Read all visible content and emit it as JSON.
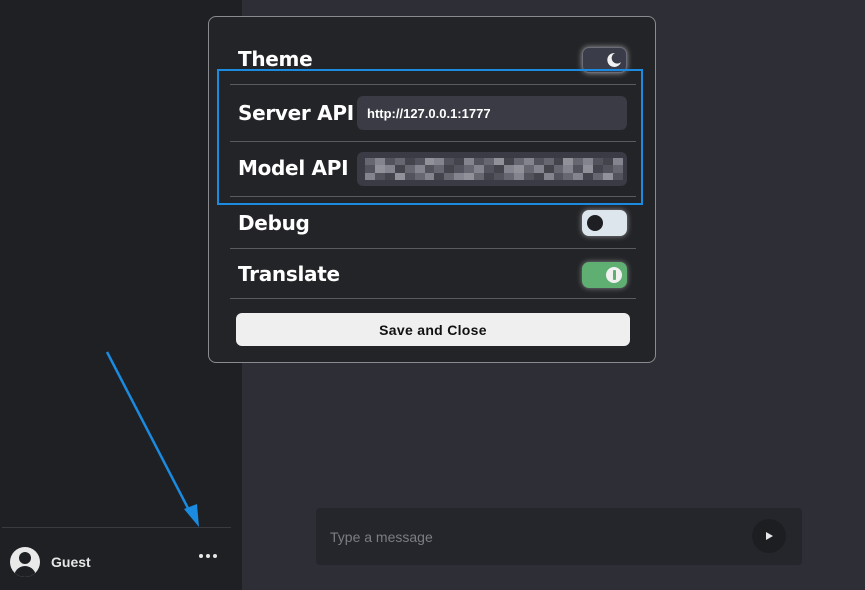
{
  "sidebar": {
    "user": {
      "name": "Guest",
      "avatar_icon": "user-avatar-icon"
    },
    "more_icon": "ellipsis-icon"
  },
  "composer": {
    "placeholder": "Type a message",
    "send_icon": "play-icon"
  },
  "settings": {
    "theme": {
      "label": "Theme",
      "mode": "dark",
      "icon": "moon-icon"
    },
    "server_api": {
      "label": "Server API",
      "value": "http://127.0.0.1:1777"
    },
    "model_api": {
      "label": "Model API",
      "value_redacted": true
    },
    "debug": {
      "label": "Debug",
      "enabled": false
    },
    "translate": {
      "label": "Translate",
      "enabled": true
    },
    "save_label": "Save and Close"
  },
  "colors": {
    "highlight": "#1a8be0",
    "translate_on": "#5fae72",
    "sidebar_bg": "#1f2023",
    "main_bg": "#2d2e36"
  }
}
